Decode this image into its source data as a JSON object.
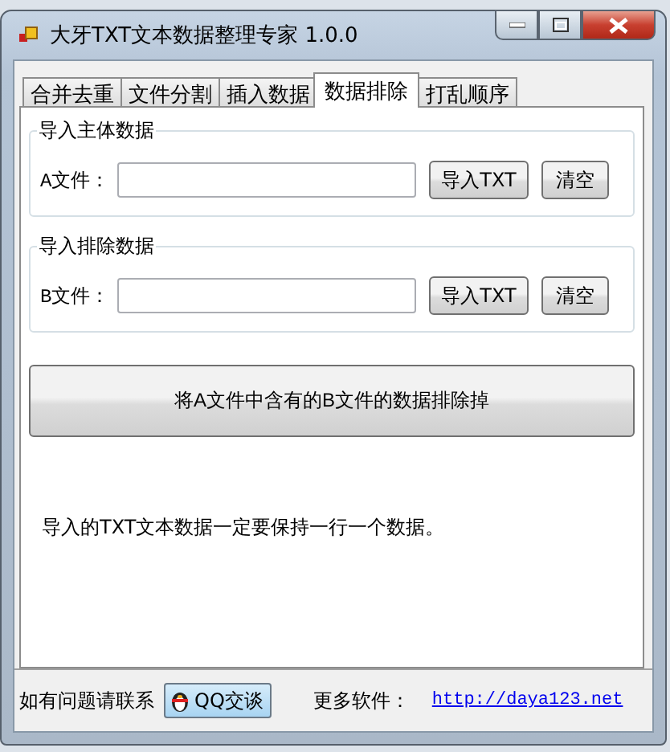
{
  "window": {
    "title": "大牙TXT文本数据整理专家 1.0.0"
  },
  "tabs": [
    {
      "label": "合并去重",
      "selected": false
    },
    {
      "label": "文件分割",
      "selected": false
    },
    {
      "label": "插入数据",
      "selected": false
    },
    {
      "label": "数据排除",
      "selected": true
    },
    {
      "label": "打乱顺序",
      "selected": false
    }
  ],
  "groups": [
    {
      "title": "导入主体数据",
      "label": "A文件：",
      "import_button": "导入TXT",
      "clear_button": "清空"
    },
    {
      "title": "导入排除数据",
      "label": "B文件：",
      "import_button": "导入TXT",
      "clear_button": "清空"
    }
  ],
  "action_button": "将A文件中含有的B文件的数据排除掉",
  "note": "导入的TXT文本数据一定要保持一行一个数据。",
  "footer": {
    "contact_label": "如有问题请联系",
    "qq_button": "QQ交谈",
    "more_label": "更多软件：",
    "link": "http://daya123.net"
  }
}
